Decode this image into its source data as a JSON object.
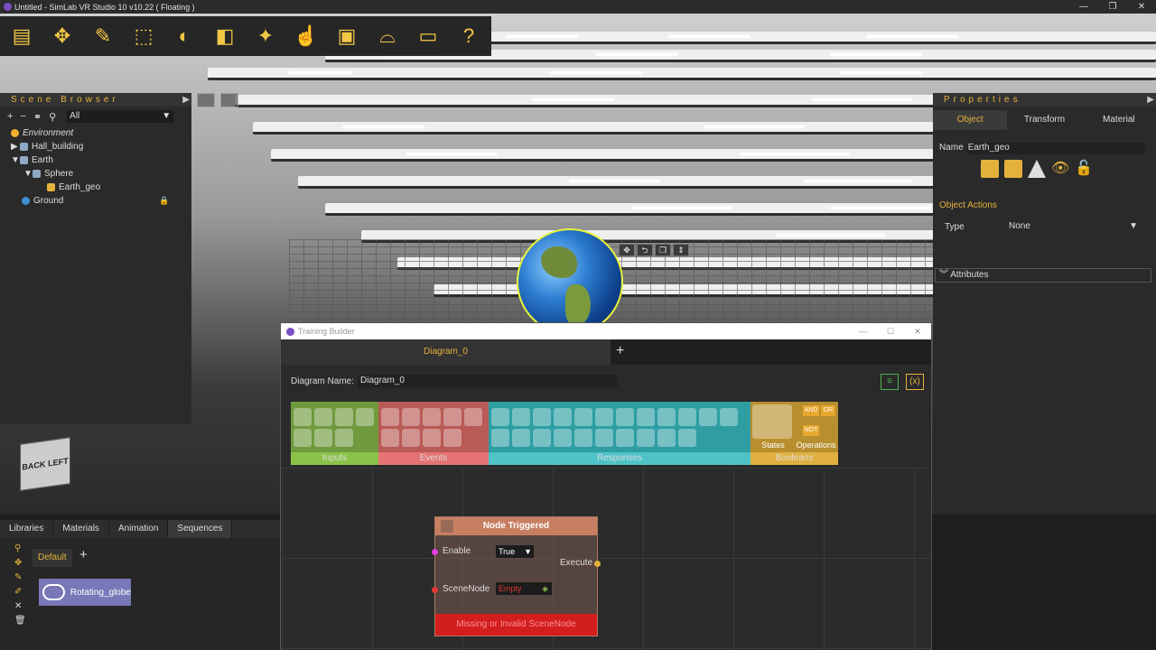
{
  "window": {
    "title": "Untitled - SimLab VR Studio 10 v10.22 ( Floating )",
    "controls": [
      "—",
      "❐",
      "✕"
    ]
  },
  "toolbar": {
    "icons": [
      "folder-icon",
      "move-icon",
      "edit-icon",
      "select-icon",
      "material-icon",
      "texture-icon",
      "effects-icon",
      "touch-icon",
      "training-icon",
      "vr-headset-icon",
      "presentation-icon",
      "help-icon"
    ]
  },
  "scene_browser": {
    "title": "Scene Browser",
    "filter": "All",
    "items": [
      {
        "label": "Environment",
        "italic": true,
        "indent": 0
      },
      {
        "label": "Hall_building",
        "indent": 1
      },
      {
        "label": "Earth",
        "indent": 1
      },
      {
        "label": "Sphere",
        "indent": 2
      },
      {
        "label": "Earth_geo",
        "indent": 3
      },
      {
        "label": "Ground",
        "indent": 1
      }
    ]
  },
  "navcube": {
    "back": "BACK",
    "left": "LEFT"
  },
  "properties": {
    "title": "Properties",
    "tabs": [
      "Object",
      "Transform",
      "Material"
    ],
    "name_label": "Name",
    "name_value": "Earth_geo",
    "object_actions": "Object Actions",
    "type_label": "Type",
    "type_value": "None",
    "attributes": "Attributes"
  },
  "bottom": {
    "tabs": [
      "Libraries",
      "Materials",
      "Animation",
      "Sequences"
    ],
    "default_tab": "Default",
    "sequence_item": "Rotating_globe"
  },
  "training_builder": {
    "title": "Training Builder",
    "diagram_tab": "Diagram_0",
    "diagram_name_label": "Diagram Name:",
    "diagram_name_value": "Diagram_0",
    "groups": [
      {
        "label": "Inputs",
        "color": "#8bc34a"
      },
      {
        "label": "Events",
        "color": "#e57373"
      },
      {
        "label": "Responses",
        "color": "#4fc3c7"
      },
      {
        "label": "Booleans",
        "color": "#e0b040"
      }
    ],
    "states_label": "States",
    "operations_label": "Operations",
    "bool_and": "AND",
    "bool_or": "OR",
    "bool_not": "NOT",
    "node": {
      "title": "Node Triggered",
      "enable_label": "Enable",
      "enable_value": "True",
      "execute_label": "Execute",
      "scenenode_label": "SceneNode",
      "scenenode_value": "Empty",
      "error": "Missing or Invalid SceneNode"
    }
  }
}
